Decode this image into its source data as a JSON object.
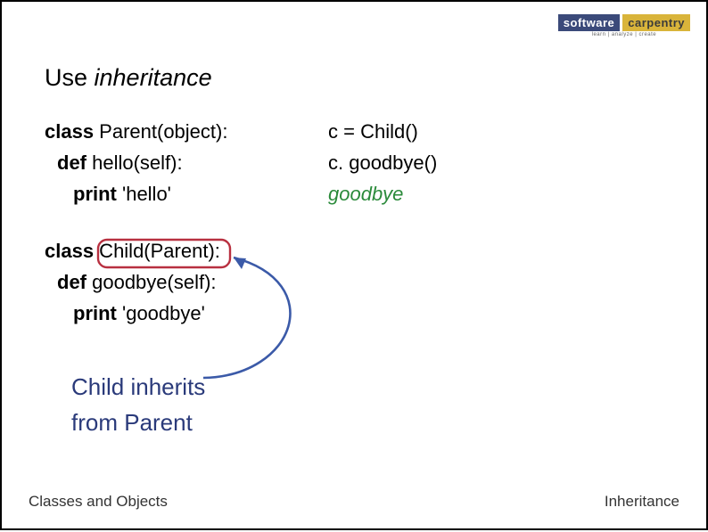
{
  "logo": {
    "left": "software",
    "right": "carpentry",
    "tagline": "learn | analyze | create"
  },
  "heading": {
    "prefix": "Use ",
    "italic": "inheritance"
  },
  "codeLeft": {
    "parent": {
      "kw": "class",
      "rest": " Parent(object):",
      "def_kw": "def",
      "def_rest": " hello(self):",
      "print_kw": "print",
      "print_rest": " 'hello'"
    },
    "child": {
      "kw": "class",
      "rest": " Child(Parent):",
      "def_kw": "def",
      "def_rest": " goodbye(self):",
      "print_kw": "print",
      "print_rest": " 'goodbye'"
    }
  },
  "codeRight": {
    "l1": "c = Child()",
    "l2": "c. goodbye()",
    "out": "goodbye"
  },
  "annotation": {
    "line1": "Child inherits",
    "line2": "from Parent"
  },
  "footer": {
    "left": "Classes and Objects",
    "right": "Inheritance"
  },
  "colors": {
    "highlight": "#b83040",
    "arrow": "#3b5aa8"
  }
}
